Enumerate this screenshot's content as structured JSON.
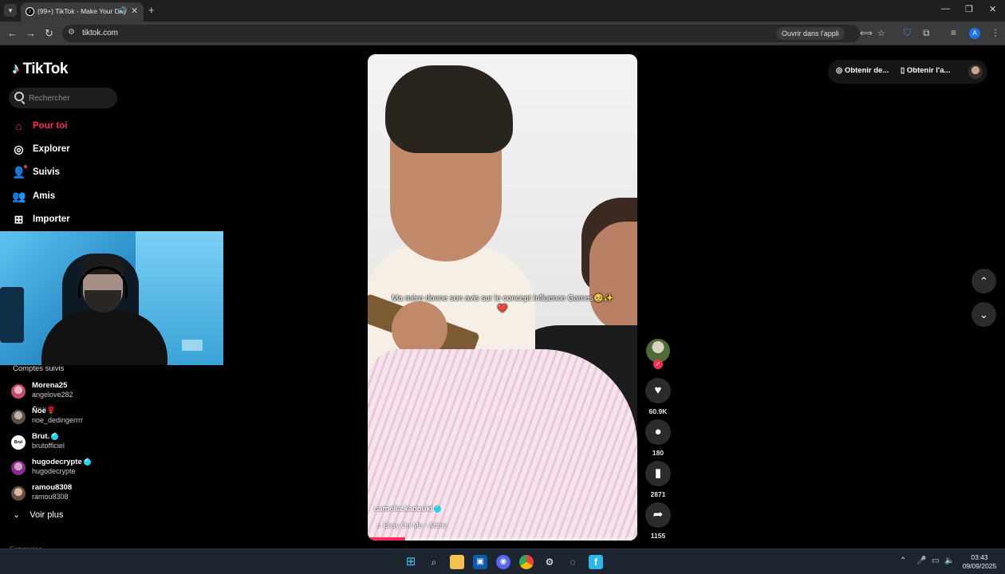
{
  "browser": {
    "tab_title": "(99+) TikTok - Make Your Day",
    "url": "tiktok.com",
    "open_in_app": "Ouvrir dans l'appli",
    "profile_initial": "A"
  },
  "tiktok": {
    "brand": "TikTok",
    "search_placeholder": "Rechercher",
    "nav": [
      {
        "label": "Pour toi",
        "icon": "home-icon"
      },
      {
        "label": "Explorer",
        "icon": "compass-icon"
      },
      {
        "label": "Suivis",
        "icon": "following-icon"
      },
      {
        "label": "Amis",
        "icon": "friends-icon"
      },
      {
        "label": "Importer",
        "icon": "upload-icon"
      }
    ],
    "followed_title": "Comptes suivis",
    "followed": [
      {
        "name": "Morena25",
        "handle": "angelove282",
        "verified": false
      },
      {
        "name": "Ñöë🌹",
        "handle": "noe_dedingerrrr",
        "verified": false
      },
      {
        "name": "Brut.",
        "handle": "brutofficiel",
        "verified": true
      },
      {
        "name": "hugodecrypte",
        "handle": "hugodecrypte",
        "verified": true
      },
      {
        "name": "ramou8308",
        "handle": "ramou8308",
        "verified": false
      }
    ],
    "see_more": "Voir plus",
    "faded_section": "Entreprise",
    "top_actions": {
      "coins": "Obtenir de...",
      "app": "Obtenir l'a..."
    }
  },
  "video": {
    "caption": "Ma mère donne son avis sur le concept Influence Games🥹✨❤️",
    "author": "camelia.kadouki",
    "music": "Easy On Me - Adele",
    "progress_percent": 14,
    "likes": "60.9K",
    "comments": "180",
    "saves": "2871",
    "shares": "1155"
  },
  "taskbar": {
    "time": "03:43",
    "date": "09/09/2025"
  },
  "colors": {
    "accent": "#fe2c55",
    "verified": "#20d5ec"
  }
}
